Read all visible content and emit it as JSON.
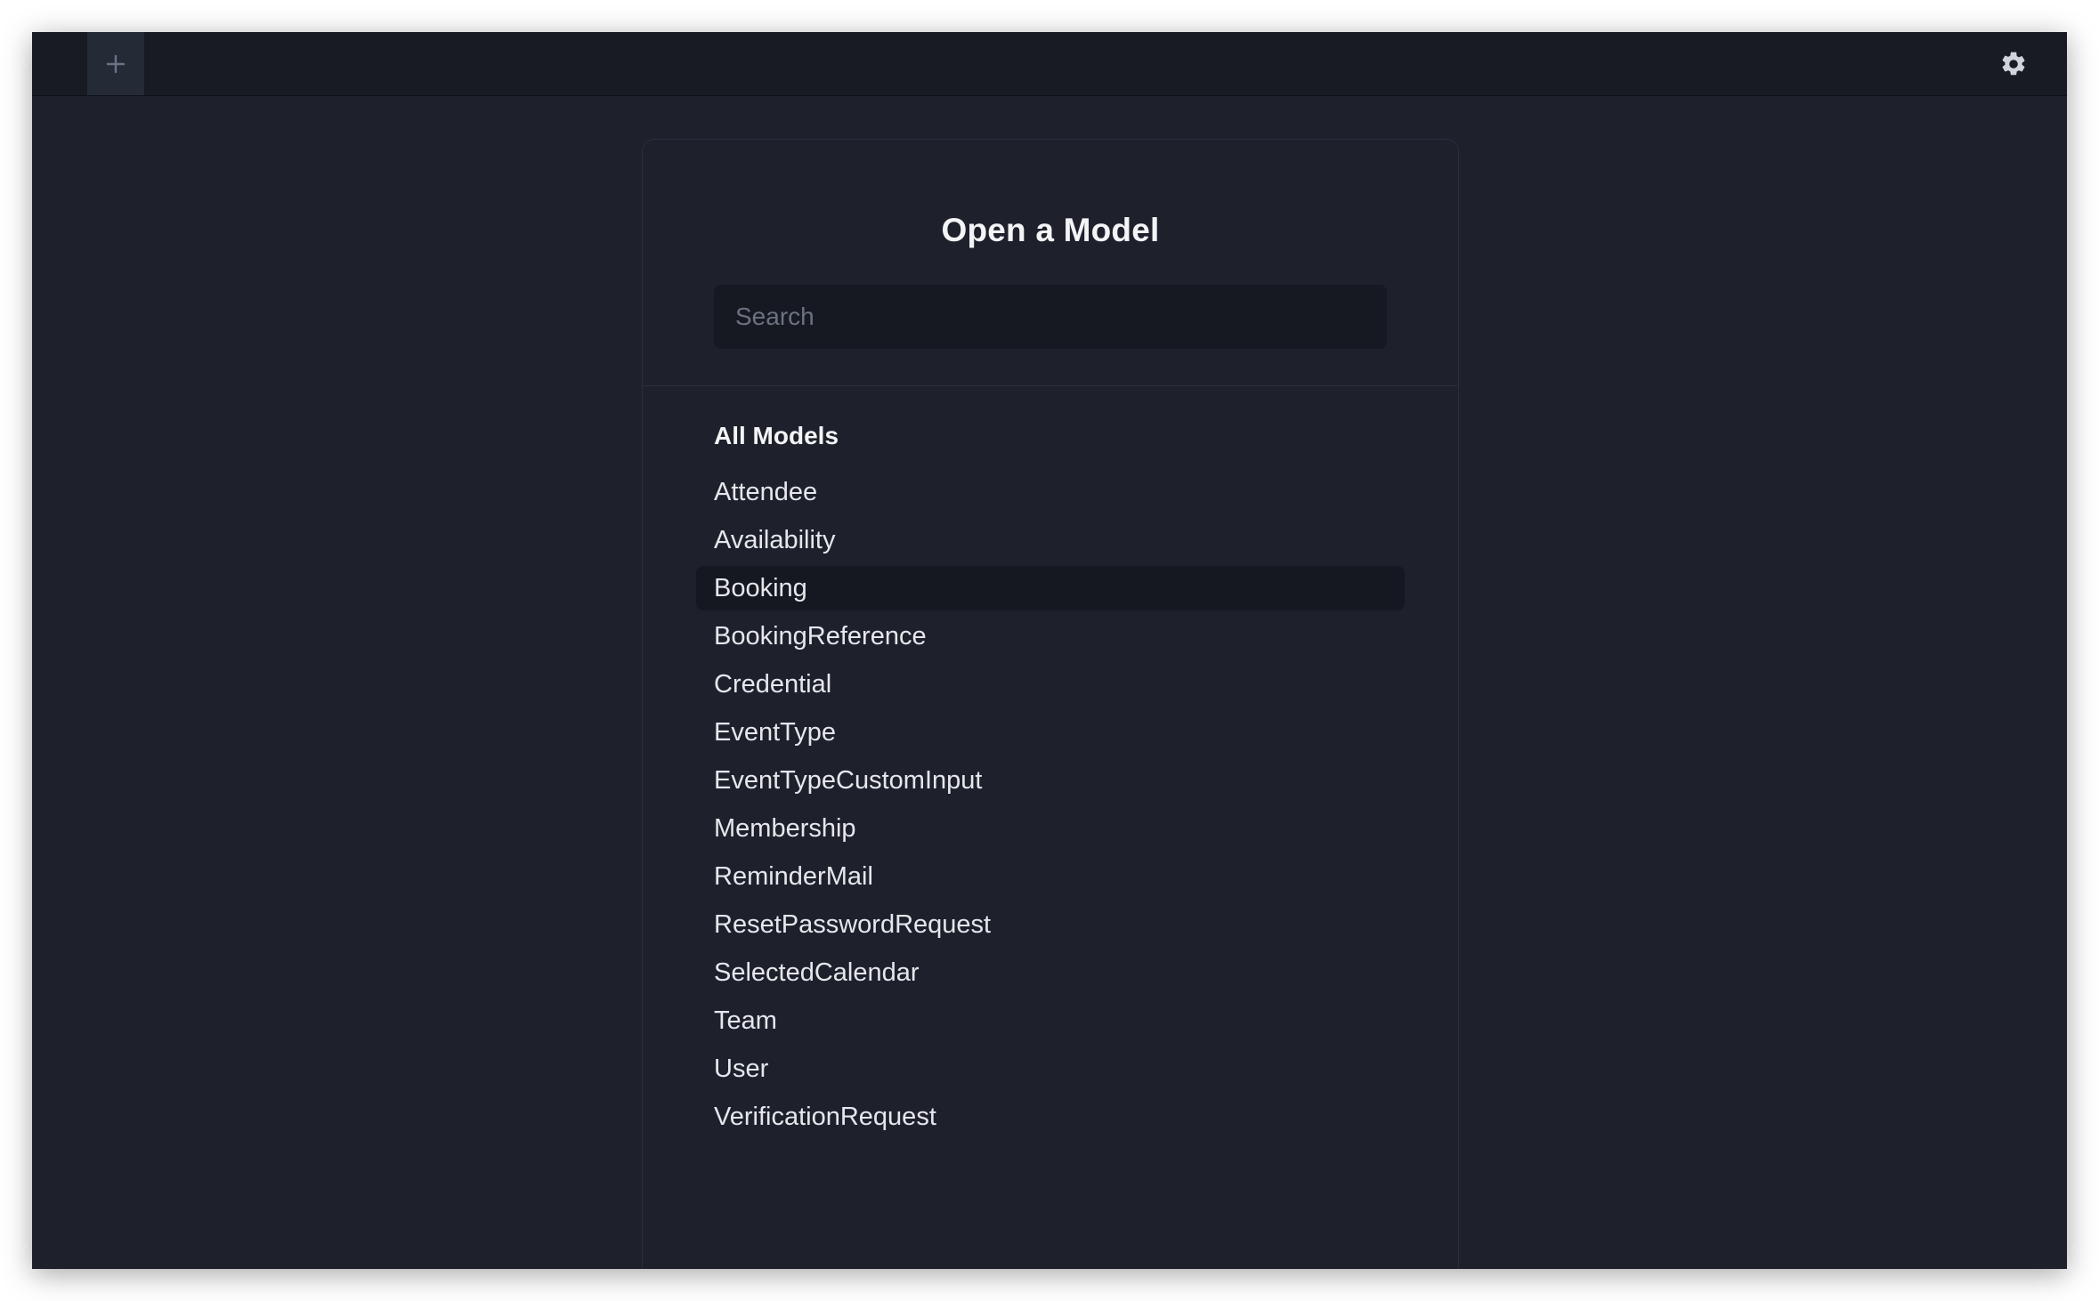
{
  "topbar": {
    "new_tab_icon": "plus-icon",
    "settings_icon": "gear-icon"
  },
  "dialog": {
    "title": "Open a Model",
    "search": {
      "placeholder": "Search",
      "value": ""
    },
    "section_heading": "All Models",
    "selected_index": 2,
    "models": [
      {
        "label": "Attendee"
      },
      {
        "label": "Availability"
      },
      {
        "label": "Booking"
      },
      {
        "label": "BookingReference"
      },
      {
        "label": "Credential"
      },
      {
        "label": "EventType"
      },
      {
        "label": "EventTypeCustomInput"
      },
      {
        "label": "Membership"
      },
      {
        "label": "ReminderMail"
      },
      {
        "label": "ResetPasswordRequest"
      },
      {
        "label": "SelectedCalendar"
      },
      {
        "label": "Team"
      },
      {
        "label": "User"
      },
      {
        "label": "VerificationRequest"
      }
    ]
  },
  "colors": {
    "background": "#1e212c",
    "topbar": "#181b24",
    "selected_row": "#151821",
    "text": "#e5e7eb"
  }
}
